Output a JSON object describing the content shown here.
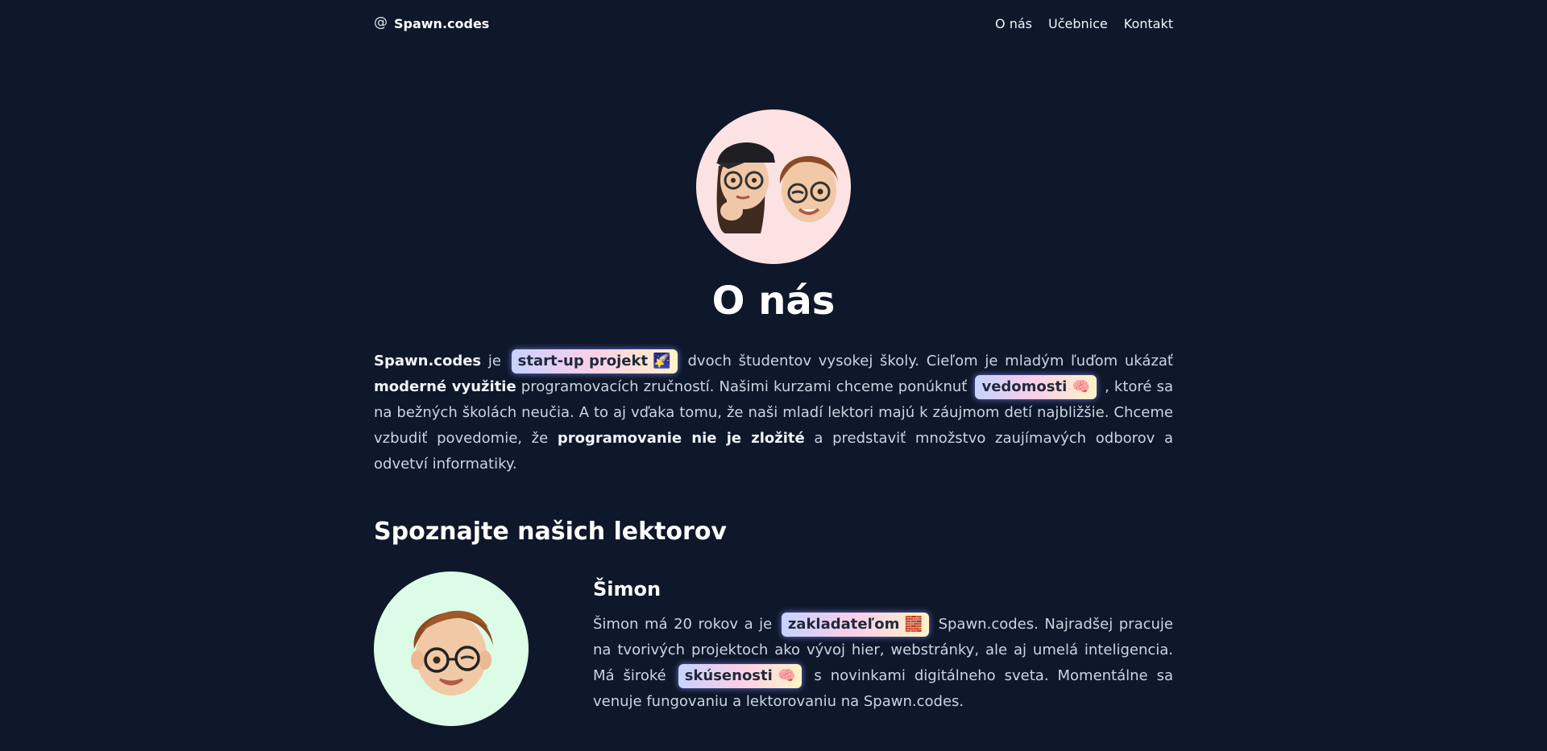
{
  "header": {
    "brand_icon": "@",
    "brand": "Spawn.codes",
    "nav": [
      "O nás",
      "Učebnice",
      "Kontakt"
    ]
  },
  "hero": {
    "title": "O nás"
  },
  "intro": {
    "p1": "Spawn.codes",
    "p2": " je ",
    "pill1": "start-up projekt 🌠",
    "p3": " dvoch študentov vysokej školy. Cieľom je mladým ľuďom ukázať ",
    "b1": "moderné využitie",
    "p4": " programovacích zručností. Našimi kurzami chceme ponúknuť ",
    "pill2": "vedomosti 🧠",
    "p5": " , ktoré sa na bežných školách neučia. A to aj vďaka tomu, že naši mladí lektori majú k záujmom detí najbližšie. Chceme vzbudiť povedomie, že ",
    "b2": "programovanie nie je zložité",
    "p6": " a predstaviť množstvo zaujímavých odborov a odvetví informatiky."
  },
  "lektori": {
    "title": "Spoznajte našich lektorov",
    "simon": {
      "name": "Šimon",
      "t1": "Šimon má 20 rokov a je ",
      "pill1": "zakladateľom 🧱",
      "t2": " Spawn.codes. Najradšej pracuje na tvorivých projektoch ako vývoj hier, webstránky, ale aj umelá inteligencia. Má široké ",
      "pill2": "skúsenosti 🧠",
      "t3": " s novinkami digitálneho sveta. Momentálne sa venuje fungovaniu a lektorovaniu na Spawn.codes."
    }
  },
  "colors": {
    "background": "#0f172a",
    "hero_avatar_bg": "#fde2e4",
    "lektor_avatar_bg": "#dcfce7"
  }
}
